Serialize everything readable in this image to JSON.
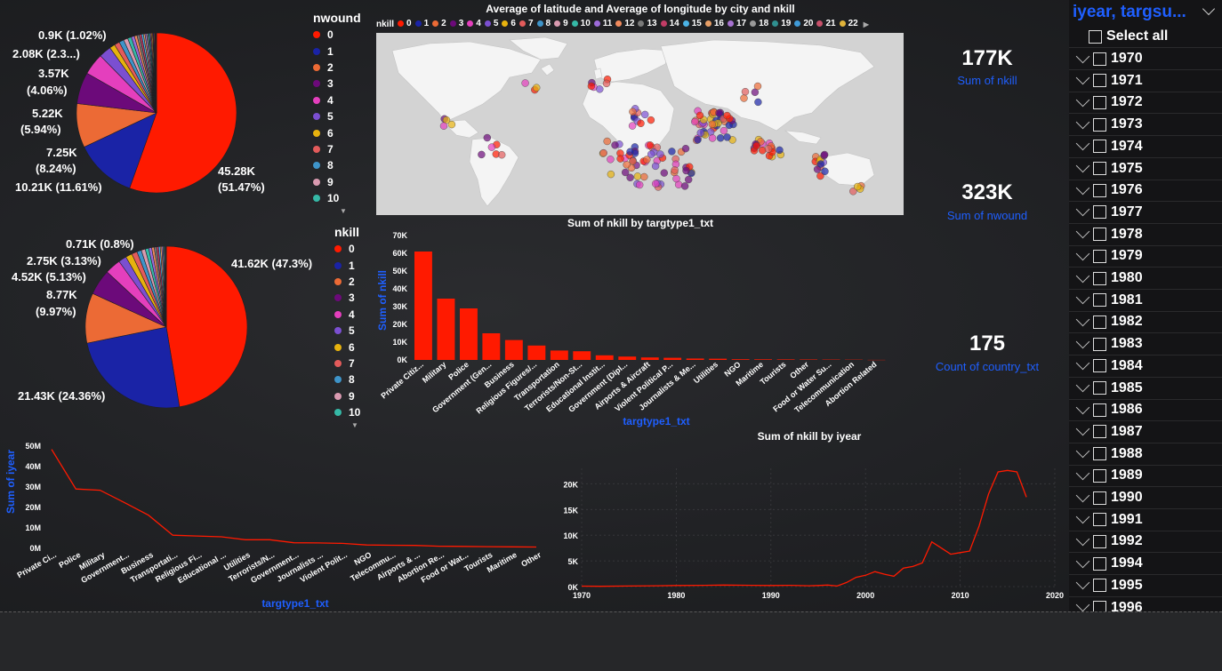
{
  "pie1": {
    "labels": [
      "45.28K",
      "(51.47%)",
      "10.21K (11.61%)",
      "7.25K",
      "(8.24%)",
      "5.22K",
      "(5.94%)",
      "3.57K",
      "(4.06%)",
      "2.08K (2.3...)",
      "0.9K (1.02%)"
    ],
    "legend_title": "nwound",
    "legend": [
      "0",
      "1",
      "2",
      "3",
      "4",
      "5",
      "6",
      "7",
      "8",
      "9",
      "10"
    ],
    "slices": [
      51.47,
      11.61,
      8.24,
      5.94,
      4.06,
      2.3,
      1.02,
      1.0,
      0.9,
      0.8,
      0.7,
      0.6,
      0.5,
      0.45,
      0.4,
      0.35,
      0.3,
      0.3,
      0.25,
      0.25,
      0.2,
      0.2,
      0.2,
      0.15,
      0.15,
      0.15,
      0.1,
      0.1,
      0.1
    ]
  },
  "pie2": {
    "labels": [
      "41.62K (47.3%)",
      "21.43K (24.36%)",
      "8.77K",
      "(9.97%)",
      "4.52K (5.13%)",
      "2.75K (3.13%)",
      "0.71K (0.8%)"
    ],
    "legend_title": "nkill",
    "legend": [
      "0",
      "1",
      "2",
      "3",
      "4",
      "5",
      "6",
      "7",
      "8",
      "9",
      "10"
    ],
    "slices": [
      47.3,
      24.36,
      9.97,
      5.13,
      3.13,
      1.6,
      1.3,
      1.1,
      0.9,
      0.8,
      0.7,
      0.6,
      0.5,
      0.45,
      0.4,
      0.35,
      0.3,
      0.25,
      0.2,
      0.2,
      0.15,
      0.1
    ]
  },
  "colors": [
    "#ff1a00",
    "#1a23a6",
    "#ec6a35",
    "#6c0a7a",
    "#e43fbd",
    "#7b4fd1",
    "#e7b20e",
    "#e35b5b",
    "#3e94c9",
    "#d99ab0",
    "#35b8a6",
    "#9c6ad9",
    "#f08a5d",
    "#7a7a7a",
    "#c23c66",
    "#4bb3e6",
    "#e79e66",
    "#a873d1",
    "#9a9a9a",
    "#2f8f8f",
    "#3f9ad8",
    "#c7506a",
    "#e0b33a"
  ],
  "map": {
    "title": "Average of latitude and Average of longitude by city and nkill",
    "legend_label": "nkill",
    "legend_items": [
      "0",
      "1",
      "2",
      "3",
      "4",
      "5",
      "6",
      "7",
      "8",
      "9",
      "10",
      "11",
      "12",
      "13",
      "14",
      "15",
      "16",
      "17",
      "18",
      "19",
      "20",
      "21",
      "22"
    ]
  },
  "kpis": [
    {
      "value": "177K",
      "label": "Sum of nkill"
    },
    {
      "value": "323K",
      "label": "Sum of nwound"
    },
    {
      "value": "175",
      "label": "Count of country_txt"
    }
  ],
  "bar_chart": {
    "title": "Sum of nkill by targtype1_txt",
    "ylabel": "Sum of nkill",
    "xlabel": "targtype1_txt",
    "yticks": [
      "0K",
      "10K",
      "20K",
      "30K",
      "40K",
      "50K",
      "60K",
      "70K"
    ]
  },
  "line_chart1": {
    "ylabel": "Sum of iyear",
    "xlabel": "targtype1_txt",
    "yticks": [
      "0M",
      "10M",
      "20M",
      "30M",
      "40M",
      "50M"
    ],
    "categories": [
      "Private Ci...",
      "Police",
      "Military",
      "Government...",
      "Business",
      "Transportati...",
      "Religious Fi...",
      "Educational ...",
      "Utilities",
      "Terrorists/N...",
      "Government...",
      "Journalists ...",
      "Violent Polit...",
      "NGO",
      "Telecommu...",
      "Airports & ...",
      "Abortion Re...",
      "Food or Wat...",
      "Tourists",
      "Maritime",
      "Other"
    ]
  },
  "line_chart2": {
    "title": "Sum of nkill by iyear",
    "xticks": [
      "1970",
      "1980",
      "1990",
      "2000",
      "2010",
      "2020"
    ],
    "yticks": [
      "0K",
      "5K",
      "10K",
      "15K",
      "20K"
    ]
  },
  "slicer": {
    "header": "iyear, targsu...",
    "select_all": "Select all",
    "years": [
      "1970",
      "1971",
      "1972",
      "1973",
      "1974",
      "1975",
      "1976",
      "1977",
      "1978",
      "1979",
      "1980",
      "1981",
      "1982",
      "1983",
      "1984",
      "1985",
      "1986",
      "1987",
      "1988",
      "1989",
      "1990",
      "1991",
      "1992",
      "1994",
      "1995",
      "1996"
    ]
  },
  "chart_data": [
    {
      "type": "bar",
      "title": "Sum of nkill by targtype1_txt",
      "xlabel": "targtype1_txt",
      "ylabel": "Sum of nkill",
      "ylim": [
        0,
        70000
      ],
      "categories": [
        "Private Citiz...",
        "Military",
        "Police",
        "Government (Gen...",
        "Business",
        "Religious Figures/...",
        "Transportation",
        "Terrorists/Non-St...",
        "Educational Instit...",
        "Government (Dipl...",
        "Airports & Aircraft",
        "Violent Political P...",
        "Journalists & Me...",
        "Utilities",
        "NGO",
        "Maritime",
        "Tourists",
        "Other",
        "Food or Water Su...",
        "Telecommunication",
        "Abortion Related"
      ],
      "values": [
        61000,
        34500,
        29000,
        15000,
        11200,
        8100,
        5300,
        4900,
        2600,
        1900,
        1400,
        1200,
        800,
        700,
        400,
        350,
        300,
        250,
        200,
        150,
        50
      ]
    },
    {
      "type": "line",
      "xlabel": "targtype1_txt",
      "ylabel": "Sum of iyear",
      "ylim": [
        0,
        50000000
      ],
      "categories": [
        "Private Ci...",
        "Police",
        "Military",
        "Government...",
        "Business",
        "Transportati...",
        "Religious Fi...",
        "Educational ...",
        "Utilities",
        "Terrorists/N...",
        "Government...",
        "Journalists ...",
        "Violent Polit...",
        "NGO",
        "Telecommu...",
        "Airports & ...",
        "Abortion Re...",
        "Food or Wat...",
        "Tourists",
        "Maritime",
        "Other"
      ],
      "values": [
        48000000,
        28600000,
        28000000,
        22000000,
        15800000,
        6000000,
        5600000,
        5200000,
        3800000,
        3800000,
        2300000,
        2200000,
        2000000,
        1200000,
        1100000,
        1000000,
        600000,
        500000,
        400000,
        300000,
        200000
      ]
    },
    {
      "type": "line",
      "title": "Sum of nkill by iyear",
      "xlim": [
        1970,
        2020
      ],
      "ylim": [
        0,
        23000
      ],
      "x": [
        1970,
        1972,
        1975,
        1978,
        1980,
        1983,
        1985,
        1988,
        1990,
        1992,
        1994,
        1995,
        1996,
        1997,
        1998,
        1999,
        2000,
        2001,
        2002,
        2003,
        2004,
        2005,
        2006,
        2007,
        2008,
        2009,
        2010,
        2011,
        2012,
        2013,
        2014,
        2015,
        2016,
        2017
      ],
      "values": [
        80,
        60,
        100,
        150,
        200,
        250,
        300,
        250,
        200,
        250,
        150,
        200,
        300,
        100,
        800,
        1800,
        2200,
        2900,
        2400,
        2000,
        3600,
        3900,
        4600,
        8700,
        7500,
        6300,
        6600,
        6900,
        11800,
        18000,
        22300,
        22600,
        22300,
        17400
      ]
    }
  ]
}
